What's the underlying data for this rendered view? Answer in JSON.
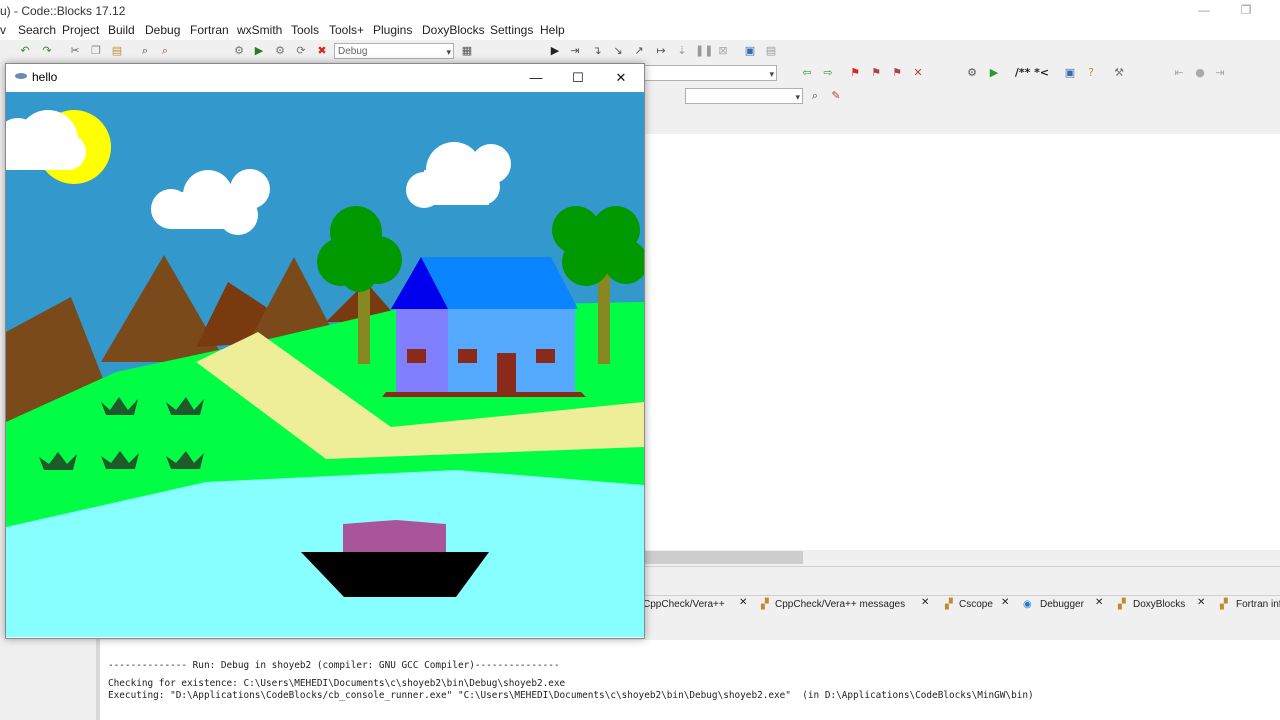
{
  "app": {
    "title": "u) - Code::Blocks 17.12"
  },
  "menu": [
    "Search",
    "Project",
    "Build",
    "Debug",
    "Fortran",
    "wxSmith",
    "Tools",
    "Tools+",
    "Plugins",
    "DoxyBlocks",
    "Settings",
    "Help"
  ],
  "toolbar": {
    "build_target": "Debug"
  },
  "hello": {
    "title": "hello"
  },
  "log_tabs": [
    "CppCheck/Vera++",
    "CppCheck/Vera++ messages",
    "Cscope",
    "Debugger",
    "DoxyBlocks",
    "Fortran inf"
  ],
  "log": {
    "line1": "-------------- Run: Debug in shoyeb2 (compiler: GNU GCC Compiler)---------------",
    "line2": "Checking for existence: C:\\Users\\MEHEDI\\Documents\\c\\shoyeb2\\bin\\Debug\\shoyeb2.exe",
    "line3": "Executing: \"D:\\Applications\\CodeBlocks/cb_console_runner.exe\" \"C:\\Users\\MEHEDI\\Documents\\c\\shoyeb2\\bin\\Debug\\shoyeb2.exe\"  (in D:\\Applications\\CodeBlocks\\MinGW\\bin)"
  },
  "colors": {
    "sky": "#3399cc",
    "sun": "#ffff00",
    "cloud": "#ffffff",
    "grass": "#00ff44",
    "path": "#eeee99",
    "river": "#88ffff",
    "mountain": "#7a4a1a",
    "roof_blue": "#0a84ff",
    "wall": "#55aaff",
    "wall_dark": "#8080ff",
    "tree": "#009900",
    "trunk": "#888822",
    "boat_hull": "#000000",
    "boat_cabin": "#aa5599"
  }
}
